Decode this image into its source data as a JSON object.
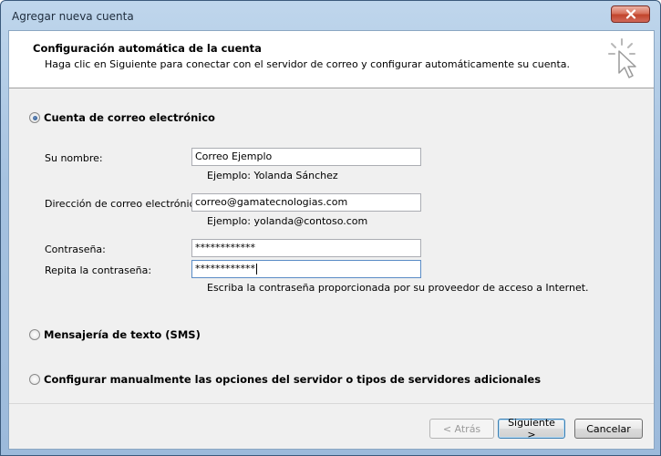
{
  "window": {
    "title": "Agregar nueva cuenta"
  },
  "header": {
    "title": "Configuración automática de la cuenta",
    "subtitle": "Haga clic en Siguiente para conectar con el servidor de correo y configurar automáticamente su cuenta."
  },
  "options": {
    "email_account": {
      "label": "Cuenta de correo electrónico",
      "selected": true
    },
    "sms": {
      "label": "Mensajería de texto (SMS)",
      "selected": false
    },
    "manual": {
      "label": "Configurar manualmente las opciones del servidor o tipos de servidores adicionales",
      "selected": false
    }
  },
  "form": {
    "name": {
      "label": "Su nombre:",
      "value": "Correo Ejemplo",
      "hint": "Ejemplo: Yolanda Sánchez"
    },
    "email": {
      "label": "Dirección de correo electrónico:",
      "value": "correo@gamatecnologias.com",
      "hint": "Ejemplo: yolanda@contoso.com"
    },
    "password": {
      "label": "Contraseña:",
      "value": "************"
    },
    "password_repeat": {
      "label": "Repita la contraseña:",
      "value": "************"
    },
    "password_hint": "Escriba la contraseña proporcionada por su proveedor de acceso a Internet."
  },
  "footer": {
    "back_label": "< Atrás",
    "next_label": "Siguiente >",
    "cancel_label": "Cancelar"
  },
  "icons": {
    "close": "close-icon",
    "header": "cursor-click-icon"
  }
}
